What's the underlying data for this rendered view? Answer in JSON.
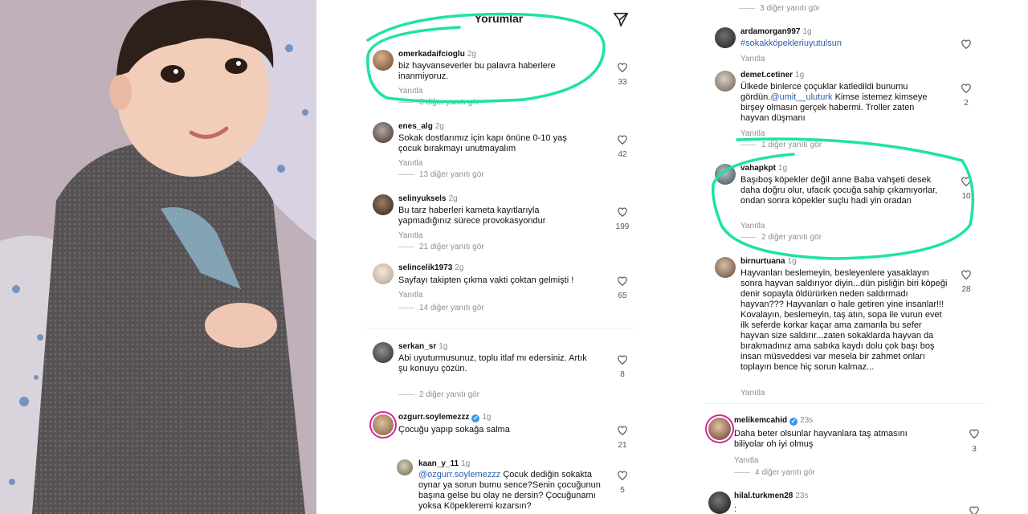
{
  "header": {
    "title": "Yorumlar",
    "send_icon": "send-icon"
  },
  "reply_label": "Yanıtla",
  "colors": {
    "accent_green": "#1ee3a0",
    "mention": "#2a5db0",
    "verified": "#3897f0"
  },
  "left_column": {
    "comments": [
      {
        "user": "omerkadaifcioglu",
        "time": "2g",
        "text": "biz hayvanseverler bu palavra haberlere inanmiyoruz.",
        "likes": "33",
        "more": "8 diğer yanıtı gör"
      },
      {
        "user": "enes_alg",
        "time": "2g",
        "text": "Sokak dostlarımız için kapı önüne 0-10 yaş çocuk bırakmayı unutmayalım",
        "likes": "42",
        "more": "13 diğer yanıtı gör"
      },
      {
        "user": "selinyuksels",
        "time": "2g",
        "text": "Bu tarz haberleri kameta kayıtlarıyla yapmadığınız sürece provokasyondur",
        "likes": "199",
        "more": "21 diğer yanıtı gör"
      },
      {
        "user": "selincelik1973",
        "time": "2g",
        "text": "Sayfayı takipten çıkma vakti çoktan gelmişti !",
        "likes": "65",
        "more": "14 diğer yanıtı gör"
      },
      {
        "user": "serkan_sr",
        "time": "1g",
        "text": "Abi uyuturmusunuz, toplu itlaf mı edersiniz. Artık şu konuyu çözün.",
        "likes": "8",
        "more": "2 diğer yanıtı gör"
      },
      {
        "user": "ozgurr.soylemezzz",
        "time": "1g",
        "text": "Çocuğu yapıp sokağa salma",
        "likes": "21"
      },
      {
        "user": "kaan_y_11",
        "time": "1g",
        "mention": "@ozgurr.soylemezzz",
        "text": " Çocuk dediğin sokakta oynar ya sorun bumu sence?Senin çocuğunun başına gelse bu olay ne dersin? Çocuğunamı yoksa Köpeklere­mi kızarsın?",
        "likes": "5"
      }
    ]
  },
  "right_column": {
    "top_more": "3 diğer yanıtı gör",
    "comments": [
      {
        "user": "ardamorgan997",
        "time": "1g",
        "text": "#sokakköpekleriuyutulsun",
        "likes": ""
      },
      {
        "user": "demet.cetiner",
        "time": "1g",
        "text_a": "Ülkede binlerce çoçuklar katledildi bunumu gördün.",
        "mention": "@umit__uluturk",
        "text_b": " Kimse istemez kimseye birşey olmasın gerçek habermi. Troller zaten hayvan düşmanı",
        "likes": "2",
        "more": "1 diğer yanıtı gör"
      },
      {
        "user": "vahapkpt",
        "time": "1g",
        "text": "Başıboş köpekler değil anne Baba vahşeti desek daha doğru olur, ufacık çocuğa sahip çıkamıyorlar, ondan sonra köpekler suçlu hadi yin oradan",
        "likes": "10",
        "more": "2 diğer yanıtı gör"
      },
      {
        "user": "birnurtuana",
        "time": "1g",
        "text": "Hayvanları beslemeyin, besleyenlere yasaklayın sonra hayvan saldırıyor diyin...dün pisliğin biri köpeği denir sopayla öldürürken neden saldırmadı hayvan??? Hayvanları o hale getiren yine insanlar!!! Kovalayın, beslemeyin, taş atın, sopa ile vurun evet ilk seferde korkar kaçar ama zamanla bu sefer hayvan size saldırır...zaten sokaklarda hayvan da bırakmadınız ama sabıka kaydı dolu çok başı boş insan müsveddesi var mesela bir zahmet onları toplayın bence hiç sorun kalmaz...",
        "likes": "28"
      },
      {
        "user": "melikemcahid",
        "time": "23s",
        "text": "Daha beter olsunlar hayvanlara taş atmasını biliyolar oh iyi olmuş",
        "likes": "3",
        "more": "4 diğer yanıtı gör"
      },
      {
        "user": "hilal.turkmen28",
        "time": "23s",
        "text": ":"
      }
    ]
  }
}
